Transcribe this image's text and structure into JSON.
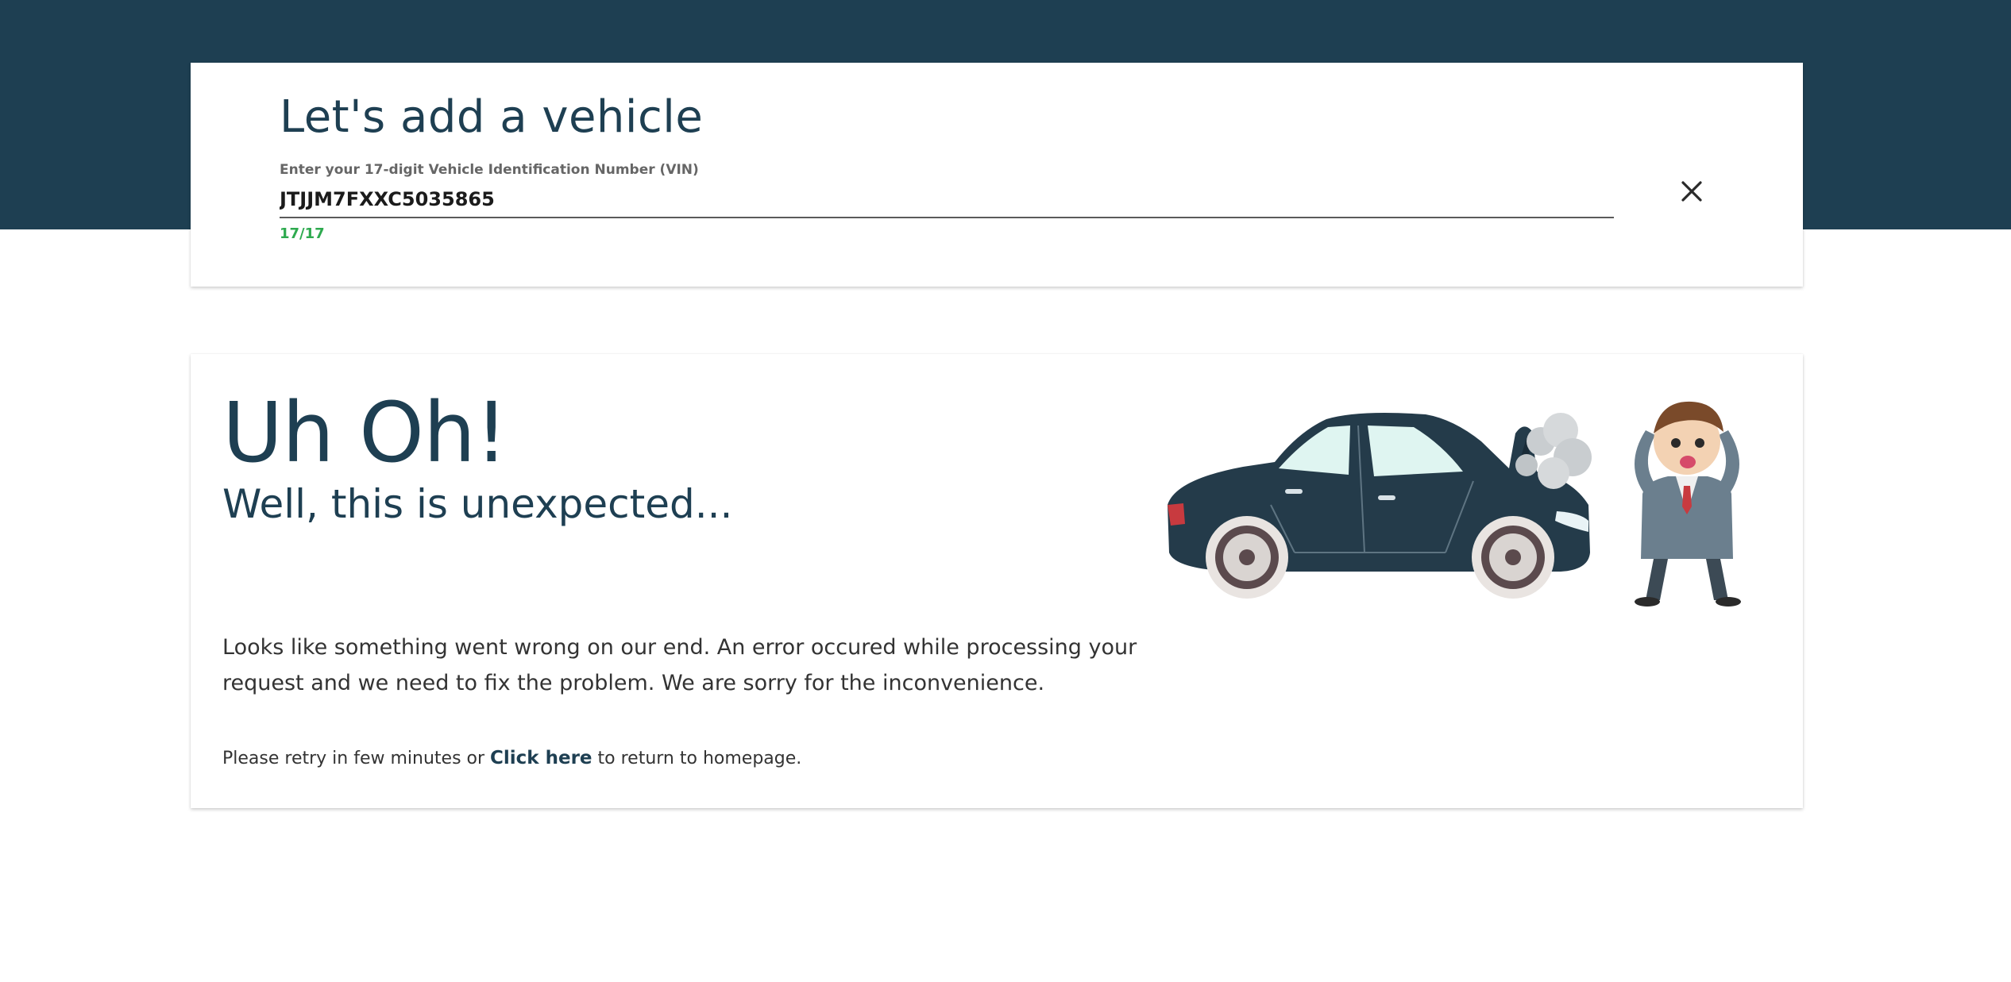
{
  "vin_card": {
    "title": "Let's add a vehicle",
    "field_label": "Enter your 17-digit Vehicle Identification Number (VIN)",
    "vin_value": "JTJJM7FXXC5035865",
    "char_counter": "17/17",
    "clear_icon": "close-icon"
  },
  "error_card": {
    "heading": "Uh Oh!",
    "subheading": "Well, this is unexpected...",
    "message": "Looks like something went wrong on our end. An error occured while processing your request and we need to fix the problem. We are sorry for the inconvenience.",
    "retry_prefix": "Please retry in few minutes or ",
    "retry_link": "Click here",
    "retry_suffix": " to return to homepage.",
    "illustration": "broken-down-car-illustration"
  },
  "colors": {
    "header_band": "#1e3f52",
    "brand_text": "#1e3f52",
    "counter_valid": "#2eaa4f",
    "car_body": "#243b4a"
  }
}
